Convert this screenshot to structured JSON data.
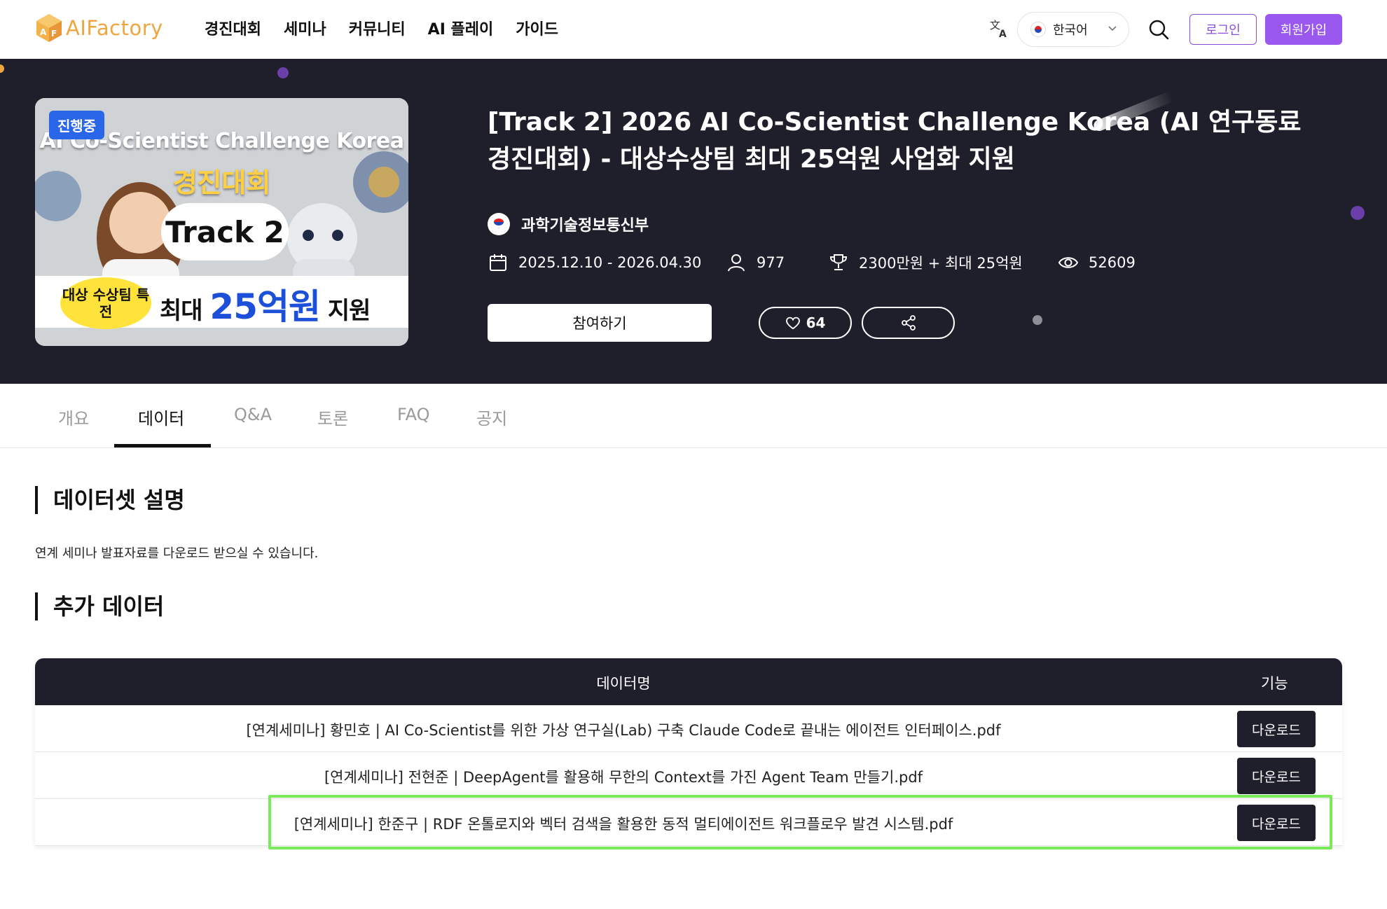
{
  "header": {
    "logo_text": "AIFactory",
    "nav": [
      "경진대회",
      "세미나",
      "커뮤니티",
      "AI 플레이",
      "가이드"
    ],
    "language": "한국어",
    "login_label": "로그인",
    "signup_label": "회원가입",
    "icons": [
      "translate-icon",
      "chevron-down-icon",
      "search-icon"
    ]
  },
  "hero": {
    "status_badge": "진행중",
    "thumbnail": {
      "title": "AI Co-Scientist Challenge Korea",
      "subtitle": "경진대회",
      "track": "Track 2",
      "badge": "대상 수상팀 특전",
      "prize_prefix": "최대 ",
      "prize_amount": "25억원",
      "prize_suffix": " 지원"
    },
    "title": "[Track 2] 2026 AI Co-Scientist Challenge Korea (AI 연구동료 경진대회) - 대상수상팀 최대 25억원 사업화 지원",
    "organizer": "과학기술정보통신부",
    "period": "2025.12.10 - 2026.04.30",
    "participants": "977",
    "prize": "2300만원 + 최대 25억원",
    "views": "52609",
    "join_label": "참여하기",
    "likes": "64",
    "colors": {
      "background": "#1f1f2b",
      "accent": "#9a58ee"
    }
  },
  "tabs": {
    "items": [
      "개요",
      "데이터",
      "Q&A",
      "토론",
      "FAQ",
      "공지"
    ],
    "active": "데이터"
  },
  "content": {
    "dataset_title": "데이터셋 설명",
    "dataset_desc": "연계 세미나 발표자료를 다운로드 받으실 수 있습니다.",
    "extra_title": "추가 데이터",
    "table": {
      "col_name": "데이터명",
      "col_function": "기능",
      "rows": [
        {
          "name": "[연계세미나] 황민호 | AI Co-Scientist를 위한 가상 연구실(Lab) 구축 Claude Code로 끝내는 에이전트 인터페이스.pdf",
          "action": "다운로드"
        },
        {
          "name": "[연계세미나] 전현준 | DeepAgent를 활용해 무한의 Context를 가진 Agent Team 만들기.pdf",
          "action": "다운로드"
        },
        {
          "name": "[연계세미나] 한준구 | RDF 온톨로지와 벡터 검색을 활용한 동적 멀티에이전트 워크플로우 발견 시스템.pdf",
          "action": "다운로드"
        }
      ]
    }
  }
}
